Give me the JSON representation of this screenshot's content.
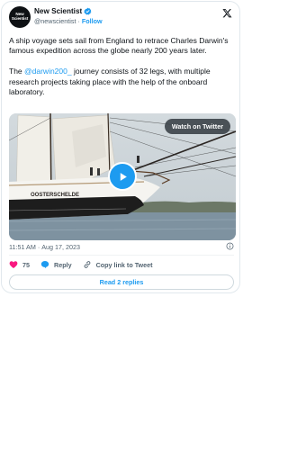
{
  "account": {
    "avatar_text": "New Scientist",
    "name": "New Scientist",
    "handle": "@newscientist",
    "separator": "·",
    "follow_label": "Follow"
  },
  "tweet": {
    "paragraph1": "A ship voyage sets sail from England to retrace Charles Darwin's famous expedition across the globe nearly 200 years later.",
    "paragraph2_before": "The ",
    "mention": "@darwin200_",
    "paragraph2_after": " journey consists of 32 legs, with multiple research projects taking place with the help of the onboard laboratory."
  },
  "media": {
    "watch_label": "Watch on Twitter",
    "ship_name": "OOSTERSCHELDE"
  },
  "meta": {
    "time": "11:51 AM",
    "separator": "·",
    "date": "Aug 17, 2023"
  },
  "actions": {
    "like_count": "75",
    "reply_label": "Reply",
    "copy_label": "Copy link to Tweet"
  },
  "read_replies_label": "Read 2 replies",
  "colors": {
    "accent": "#1d9bf0",
    "like": "#f91880",
    "text": "#0f1419",
    "muted": "#536471"
  }
}
